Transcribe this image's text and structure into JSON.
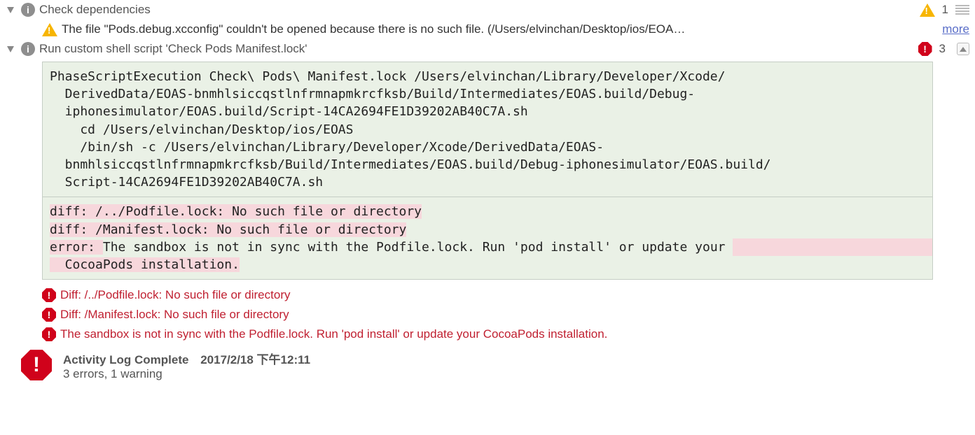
{
  "section1": {
    "title": "Check dependencies",
    "warning_count": "1",
    "warning_line": "The file \"Pods.debug.xcconfig\" couldn't be opened because there is no such file. (/Users/elvinchan/Desktop/ios/EOA…",
    "more": "more"
  },
  "section2": {
    "title": "Run custom shell script 'Check Pods Manifest.lock'",
    "error_count": "3",
    "code1": "PhaseScriptExecution Check\\ Pods\\ Manifest.lock /Users/elvinchan/Library/Developer/Xcode/\n  DerivedData/EOAS-bnmhlsiccqstlnfrmnapmkrcfksb/Build/Intermediates/EOAS.build/Debug-\n  iphonesimulator/EOAS.build/Script-14CA2694FE1D39202AB40C7A.sh\n    cd /Users/elvinchan/Desktop/ios/EOAS\n    /bin/sh -c /Users/elvinchan/Library/Developer/Xcode/DerivedData/EOAS-\n  bnmhlsiccqstlnfrmnapmkrcfksb/Build/Intermediates/EOAS.build/Debug-iphonesimulator/EOAS.build/\n  Script-14CA2694FE1D39202AB40C7A.sh",
    "code2_l1": "diff: /../Podfile.lock: No such file or directory",
    "code2_l2": "diff: /Manifest.lock: No such file or directory",
    "code2_l3a": "error: ",
    "code2_l3b": "The sandbox is not in sync with the Podfile.lock. Run 'pod install' or update your ",
    "code2_l4": "  CocoaPods installation.",
    "errors": [
      "Diff: /../Podfile.lock: No such file or directory",
      "Diff: /Manifest.lock: No such file or directory",
      "The sandbox is not in sync with the Podfile.lock. Run 'pod install' or update your CocoaPods installation."
    ]
  },
  "summary": {
    "title": "Activity Log Complete",
    "timestamp": "2017/2/18 下午12:11",
    "detail": "3 errors, 1 warning"
  }
}
